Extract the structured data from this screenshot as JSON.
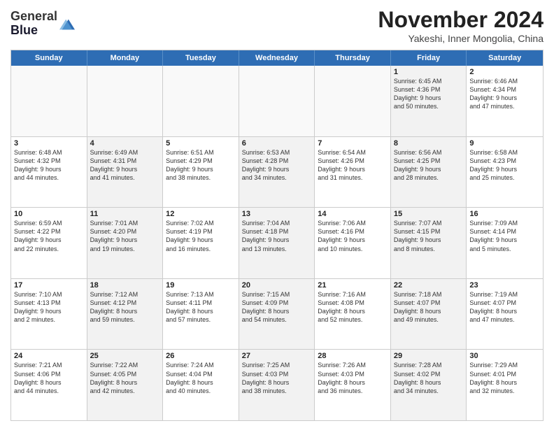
{
  "logo": {
    "line1": "General",
    "line2": "Blue"
  },
  "title": "November 2024",
  "subtitle": "Yakeshi, Inner Mongolia, China",
  "days": [
    "Sunday",
    "Monday",
    "Tuesday",
    "Wednesday",
    "Thursday",
    "Friday",
    "Saturday"
  ],
  "rows": [
    [
      {
        "day": "",
        "text": ""
      },
      {
        "day": "",
        "text": ""
      },
      {
        "day": "",
        "text": ""
      },
      {
        "day": "",
        "text": ""
      },
      {
        "day": "",
        "text": ""
      },
      {
        "day": "1",
        "text": "Sunrise: 6:45 AM\nSunset: 4:36 PM\nDaylight: 9 hours\nand 50 minutes."
      },
      {
        "day": "2",
        "text": "Sunrise: 6:46 AM\nSunset: 4:34 PM\nDaylight: 9 hours\nand 47 minutes."
      }
    ],
    [
      {
        "day": "3",
        "text": "Sunrise: 6:48 AM\nSunset: 4:32 PM\nDaylight: 9 hours\nand 44 minutes."
      },
      {
        "day": "4",
        "text": "Sunrise: 6:49 AM\nSunset: 4:31 PM\nDaylight: 9 hours\nand 41 minutes."
      },
      {
        "day": "5",
        "text": "Sunrise: 6:51 AM\nSunset: 4:29 PM\nDaylight: 9 hours\nand 38 minutes."
      },
      {
        "day": "6",
        "text": "Sunrise: 6:53 AM\nSunset: 4:28 PM\nDaylight: 9 hours\nand 34 minutes."
      },
      {
        "day": "7",
        "text": "Sunrise: 6:54 AM\nSunset: 4:26 PM\nDaylight: 9 hours\nand 31 minutes."
      },
      {
        "day": "8",
        "text": "Sunrise: 6:56 AM\nSunset: 4:25 PM\nDaylight: 9 hours\nand 28 minutes."
      },
      {
        "day": "9",
        "text": "Sunrise: 6:58 AM\nSunset: 4:23 PM\nDaylight: 9 hours\nand 25 minutes."
      }
    ],
    [
      {
        "day": "10",
        "text": "Sunrise: 6:59 AM\nSunset: 4:22 PM\nDaylight: 9 hours\nand 22 minutes."
      },
      {
        "day": "11",
        "text": "Sunrise: 7:01 AM\nSunset: 4:20 PM\nDaylight: 9 hours\nand 19 minutes."
      },
      {
        "day": "12",
        "text": "Sunrise: 7:02 AM\nSunset: 4:19 PM\nDaylight: 9 hours\nand 16 minutes."
      },
      {
        "day": "13",
        "text": "Sunrise: 7:04 AM\nSunset: 4:18 PM\nDaylight: 9 hours\nand 13 minutes."
      },
      {
        "day": "14",
        "text": "Sunrise: 7:06 AM\nSunset: 4:16 PM\nDaylight: 9 hours\nand 10 minutes."
      },
      {
        "day": "15",
        "text": "Sunrise: 7:07 AM\nSunset: 4:15 PM\nDaylight: 9 hours\nand 8 minutes."
      },
      {
        "day": "16",
        "text": "Sunrise: 7:09 AM\nSunset: 4:14 PM\nDaylight: 9 hours\nand 5 minutes."
      }
    ],
    [
      {
        "day": "17",
        "text": "Sunrise: 7:10 AM\nSunset: 4:13 PM\nDaylight: 9 hours\nand 2 minutes."
      },
      {
        "day": "18",
        "text": "Sunrise: 7:12 AM\nSunset: 4:12 PM\nDaylight: 8 hours\nand 59 minutes."
      },
      {
        "day": "19",
        "text": "Sunrise: 7:13 AM\nSunset: 4:11 PM\nDaylight: 8 hours\nand 57 minutes."
      },
      {
        "day": "20",
        "text": "Sunrise: 7:15 AM\nSunset: 4:09 PM\nDaylight: 8 hours\nand 54 minutes."
      },
      {
        "day": "21",
        "text": "Sunrise: 7:16 AM\nSunset: 4:08 PM\nDaylight: 8 hours\nand 52 minutes."
      },
      {
        "day": "22",
        "text": "Sunrise: 7:18 AM\nSunset: 4:07 PM\nDaylight: 8 hours\nand 49 minutes."
      },
      {
        "day": "23",
        "text": "Sunrise: 7:19 AM\nSunset: 4:07 PM\nDaylight: 8 hours\nand 47 minutes."
      }
    ],
    [
      {
        "day": "24",
        "text": "Sunrise: 7:21 AM\nSunset: 4:06 PM\nDaylight: 8 hours\nand 44 minutes."
      },
      {
        "day": "25",
        "text": "Sunrise: 7:22 AM\nSunset: 4:05 PM\nDaylight: 8 hours\nand 42 minutes."
      },
      {
        "day": "26",
        "text": "Sunrise: 7:24 AM\nSunset: 4:04 PM\nDaylight: 8 hours\nand 40 minutes."
      },
      {
        "day": "27",
        "text": "Sunrise: 7:25 AM\nSunset: 4:03 PM\nDaylight: 8 hours\nand 38 minutes."
      },
      {
        "day": "28",
        "text": "Sunrise: 7:26 AM\nSunset: 4:03 PM\nDaylight: 8 hours\nand 36 minutes."
      },
      {
        "day": "29",
        "text": "Sunrise: 7:28 AM\nSunset: 4:02 PM\nDaylight: 8 hours\nand 34 minutes."
      },
      {
        "day": "30",
        "text": "Sunrise: 7:29 AM\nSunset: 4:01 PM\nDaylight: 8 hours\nand 32 minutes."
      }
    ]
  ]
}
